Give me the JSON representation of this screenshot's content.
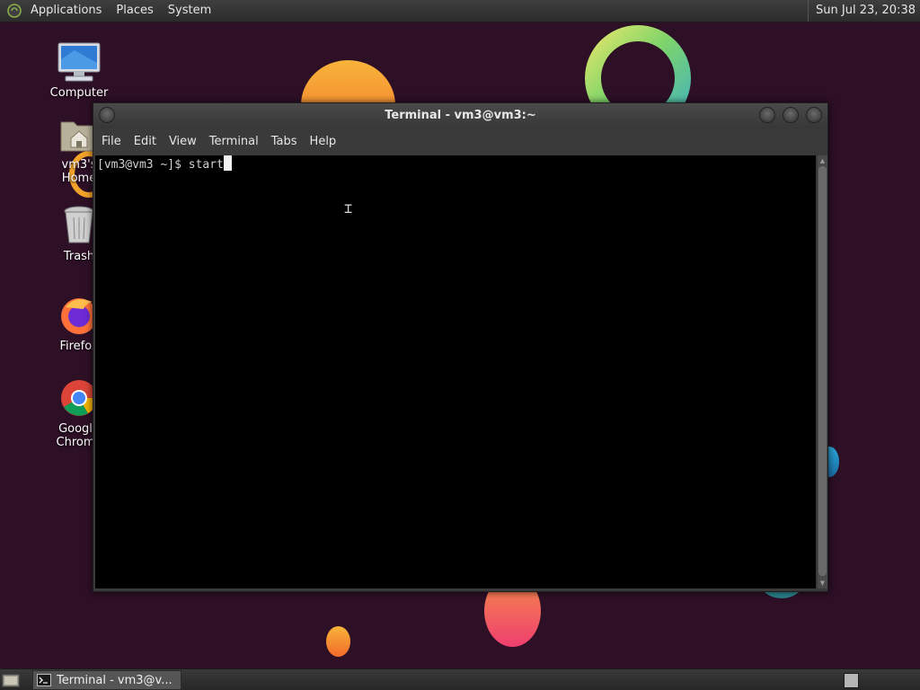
{
  "top_panel": {
    "menus": [
      "Applications",
      "Places",
      "System"
    ],
    "clock": "Sun Jul 23, 20:38"
  },
  "desktop_icons": [
    {
      "label": "Computer",
      "icon": "computer-icon"
    },
    {
      "label": "vm3's Home",
      "icon": "home-folder-icon"
    },
    {
      "label": "Trash",
      "icon": "trash-icon"
    },
    {
      "label": "Firefox",
      "icon": "firefox-icon"
    },
    {
      "label": "Google Chrome",
      "icon": "chrome-icon"
    }
  ],
  "terminal": {
    "title": "Terminal - vm3@vm3:~",
    "menu": [
      "File",
      "Edit",
      "View",
      "Terminal",
      "Tabs",
      "Help"
    ],
    "prompt": "[vm3@vm3 ~]$ ",
    "command": "start"
  },
  "taskbar": {
    "terminal_label": "Terminal - vm3@v..."
  },
  "colors": {
    "wallpaper": "#2d0f26",
    "panel": "#2c2c2c",
    "terminal_bg": "#000000"
  }
}
